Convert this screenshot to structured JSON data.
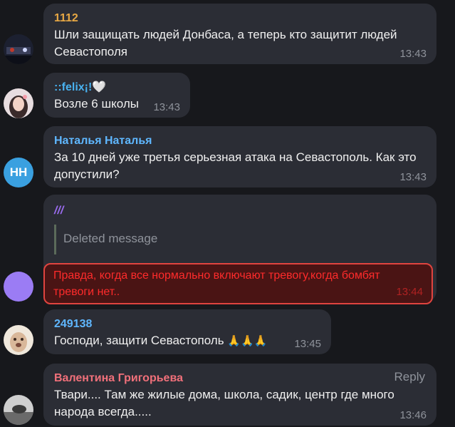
{
  "colors": {
    "bg": "#17181c",
    "bubble": "#2b2d35",
    "alert": "#ff2b2b"
  },
  "messages": [
    {
      "author": "1112",
      "author_color": "#e8a844",
      "text": "Шли защищать людей Донбаса, а теперь кто защитит людей Севастополя",
      "time": "13:43",
      "avatar": "photo-dark"
    },
    {
      "author": "::felix¡!🤍",
      "author_color": "#49b2f0",
      "text": "Возле 6 школы",
      "time": "13:43",
      "avatar": "photo-girl"
    },
    {
      "author": "Наталья Наталья",
      "author_color": "#5fb7ff",
      "text": "За 10 дней уже третья серьезная атака на Севастополь. Как это допустили?",
      "time": "13:43",
      "avatar_initials": "НН",
      "avatar_color": "#3aa0e0"
    },
    {
      "author": "///",
      "author_color": "#9b6cf0",
      "quote": "Deleted message",
      "text": "Правда, когда все нормально включают тревогу,когда бомбят тревоги нет..",
      "time": "13:44",
      "avatar_color": "#9b7cf4"
    },
    {
      "author": "249138",
      "author_color": "#5fb7ff",
      "text": "Господи, защити Севастополь",
      "emoji": "🙏🙏🙏",
      "time": "13:45",
      "avatar": "photo-dog"
    },
    {
      "author": "Валентина Григорьева",
      "author_color": "#f0707a",
      "reply_label": "Reply",
      "text": "Твари.... Там же жилые дома, школа, садик, центр где много народа всегда.....",
      "time": "13:46",
      "avatar": "photo-bw"
    }
  ]
}
